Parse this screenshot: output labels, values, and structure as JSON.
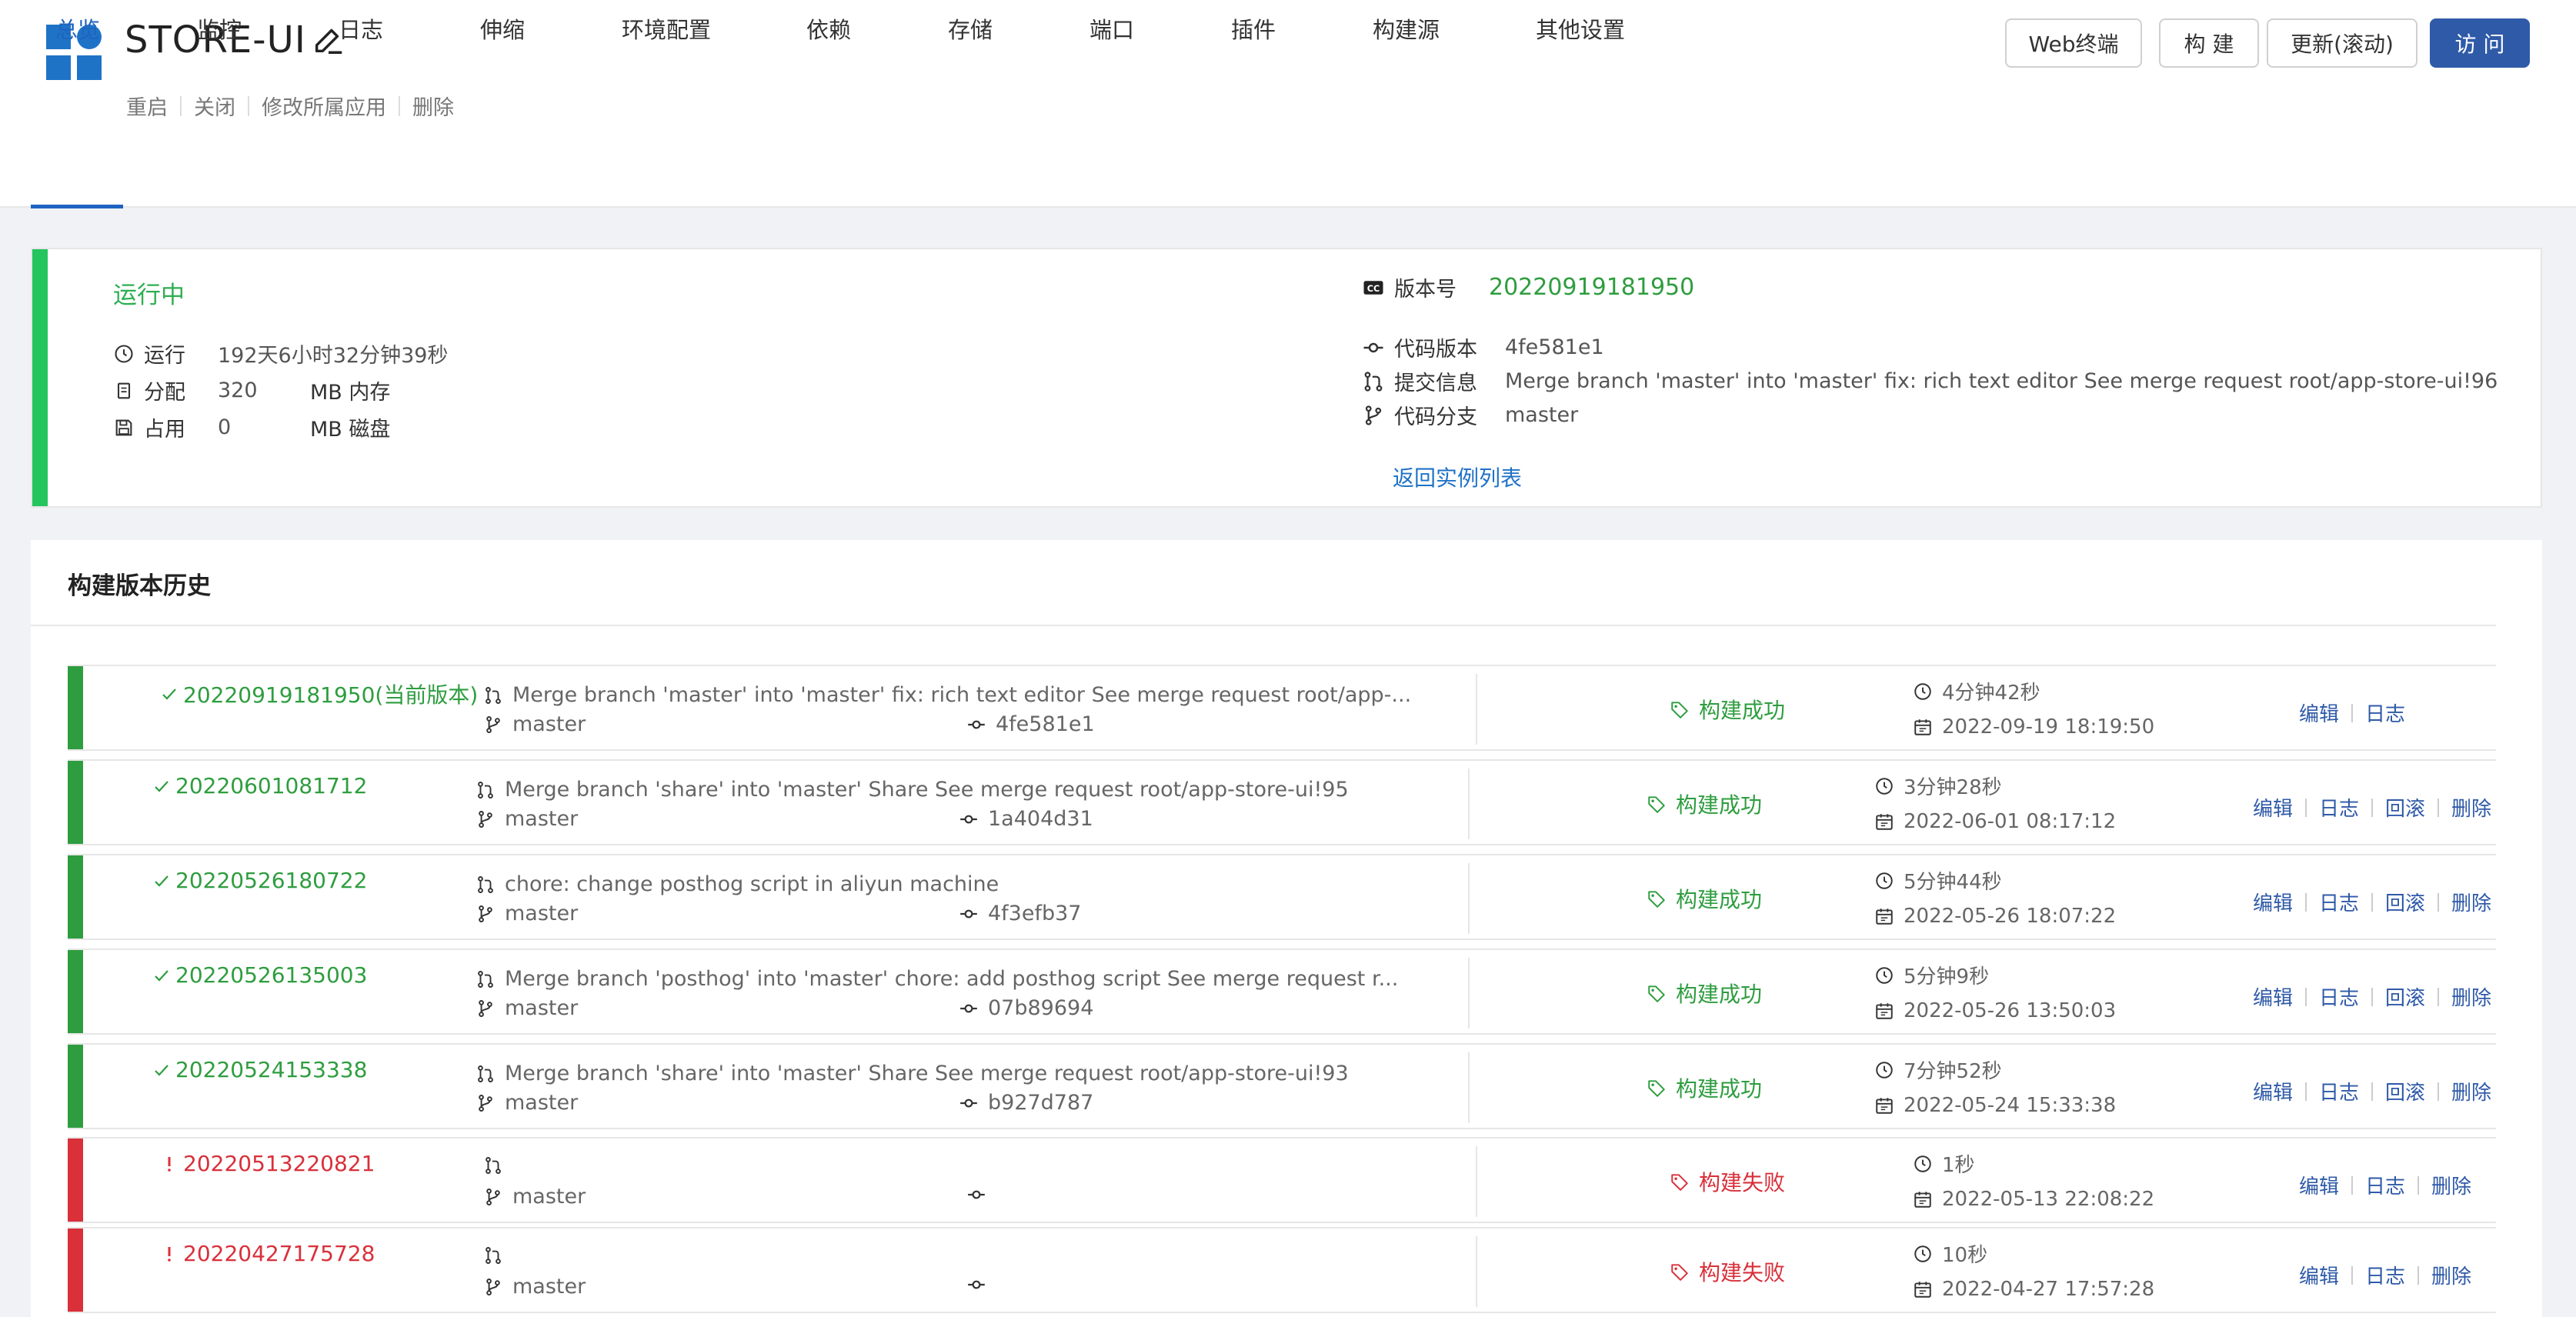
{
  "app": {
    "title": "STORE-UI"
  },
  "sub_actions": [
    "重启",
    "关闭",
    "修改所属应用",
    "删除"
  ],
  "top_buttons": {
    "terminal": "Web终端",
    "build": "构 建",
    "update": "更新(滚动)",
    "visit": "访 问"
  },
  "tabs": [
    "总览",
    "监控",
    "日志",
    "伸缩",
    "环境配置",
    "依赖",
    "存储",
    "端口",
    "插件",
    "构建源",
    "其他设置"
  ],
  "active_tab": "总览",
  "status": {
    "state": "运行中",
    "run_label": "运行",
    "run_value": "192天6小时32分钟39秒",
    "alloc_label": "分配",
    "alloc_value": "320",
    "alloc_unit": "MB 内存",
    "use_label": "占用",
    "use_value": "0",
    "use_unit": "MB 磁盘"
  },
  "version": {
    "version_label": "版本号",
    "version_value": "20220919181950",
    "code_label": "代码版本",
    "code_value": "4fe581e1",
    "commit_label": "提交信息",
    "commit_value": "Merge branch 'master' into 'master' fix: rich text editor See merge request root/app-store-ui!96",
    "branch_label": "代码分支",
    "branch_value": "master",
    "back_link": "返回实例列表"
  },
  "history": {
    "title": "构建版本历史",
    "rows": [
      {
        "version": "20220919181950(当前版本)",
        "message": "Merge branch 'master' into 'master' fix: rich text editor See merge request root/app-...",
        "branch": "master",
        "commit": "4fe581e1",
        "state": "构建成功",
        "duration": "4分钟42秒",
        "date": "2022-09-19 18:19:50",
        "ops": [
          "编辑",
          "日志"
        ]
      },
      {
        "version": "20220601081712",
        "message": "Merge branch 'share' into 'master' Share See merge request root/app-store-ui!95",
        "branch": "master",
        "commit": "1a404d31",
        "state": "构建成功",
        "duration": "3分钟28秒",
        "date": "2022-06-01 08:17:12",
        "ops": [
          "编辑",
          "日志",
          "回滚",
          "删除"
        ]
      },
      {
        "version": "20220526180722",
        "message": "chore: change posthog script in aliyun machine",
        "branch": "master",
        "commit": "4f3efb37",
        "state": "构建成功",
        "duration": "5分钟44秒",
        "date": "2022-05-26 18:07:22",
        "ops": [
          "编辑",
          "日志",
          "回滚",
          "删除"
        ]
      },
      {
        "version": "20220526135003",
        "message": "Merge branch 'posthog' into 'master' chore: add posthog script See merge request r...",
        "branch": "master",
        "commit": "07b89694",
        "state": "构建成功",
        "duration": "5分钟9秒",
        "date": "2022-05-26 13:50:03",
        "ops": [
          "编辑",
          "日志",
          "回滚",
          "删除"
        ]
      },
      {
        "version": "20220524153338",
        "message": "Merge branch 'share' into 'master' Share See merge request root/app-store-ui!93",
        "branch": "master",
        "commit": "b927d787",
        "state": "构建成功",
        "duration": "7分钟52秒",
        "date": "2022-05-24 15:33:38",
        "ops": [
          "编辑",
          "日志",
          "回滚",
          "删除"
        ]
      },
      {
        "version": "20220513220821",
        "message": "",
        "branch": "master",
        "commit": "",
        "state": "构建失败",
        "duration": "1秒",
        "date": "2022-05-13 22:08:22",
        "ops": [
          "编辑",
          "日志",
          "删除"
        ]
      },
      {
        "version": "20220427175728",
        "message": "",
        "branch": "master",
        "commit": "",
        "state": "构建失败",
        "duration": "10秒",
        "date": "2022-04-27 17:57:28",
        "ops": [
          "编辑",
          "日志",
          "删除"
        ]
      }
    ]
  },
  "colors": {
    "accent": "#2f5aa8",
    "success": "#2e9d3f",
    "fail": "#d9303a",
    "running": "#24c45e",
    "link": "#1f73c7"
  },
  "icons": [
    "app-logo-icon",
    "pencil-icon",
    "clock-icon",
    "memory-icon",
    "disk-icon",
    "cc-icon",
    "commit-icon",
    "merge-icon",
    "branch-icon",
    "tag-icon",
    "calendar-icon",
    "check-icon",
    "alert-icon"
  ]
}
